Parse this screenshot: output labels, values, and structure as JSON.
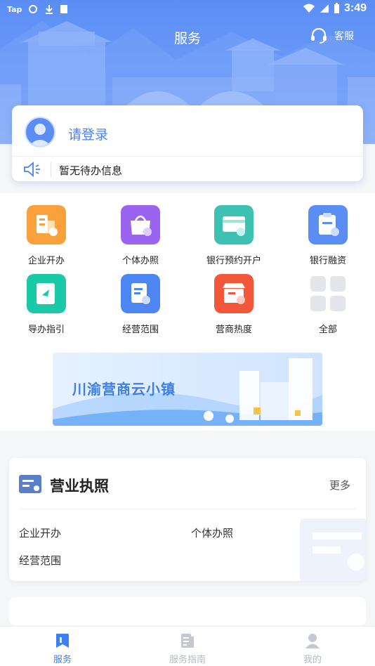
{
  "status_bar": {
    "left_text": "Tap",
    "time": "3:49"
  },
  "header": {
    "title": "服务",
    "service_label": "客服"
  },
  "login": {
    "prompt": "请登录",
    "notice": "暂无待办信息"
  },
  "services": [
    {
      "label": "企业开办",
      "icon": "building-icon",
      "color": "#f9a23b"
    },
    {
      "label": "个体办照",
      "icon": "shopping-bag-icon",
      "color": "#9b64f0"
    },
    {
      "label": "银行预约开户",
      "icon": "bank-card-icon",
      "color": "#3cc1b3"
    },
    {
      "label": "银行融资",
      "icon": "clipboard-yen-icon",
      "color": "#5b8ef5"
    },
    {
      "label": "导办指引",
      "icon": "guide-book-icon",
      "color": "#1bc9a8"
    },
    {
      "label": "经营范围",
      "icon": "document-search-icon",
      "color": "#4d86f2"
    },
    {
      "label": "营商热度",
      "icon": "shop-fire-icon",
      "color": "#f2573a"
    },
    {
      "label": "全部",
      "icon": "grid-all-icon",
      "color": "#e3e5ea"
    }
  ],
  "banner": {
    "text": "川渝营商云小镇"
  },
  "license_section": {
    "title": "营业执照",
    "more": "更多",
    "items": [
      "企业开办",
      "个体办照",
      "经营范围"
    ]
  },
  "tabbar": [
    {
      "label": "服务",
      "active": true
    },
    {
      "label": "服务指南",
      "active": false
    },
    {
      "label": "我的",
      "active": false
    }
  ]
}
